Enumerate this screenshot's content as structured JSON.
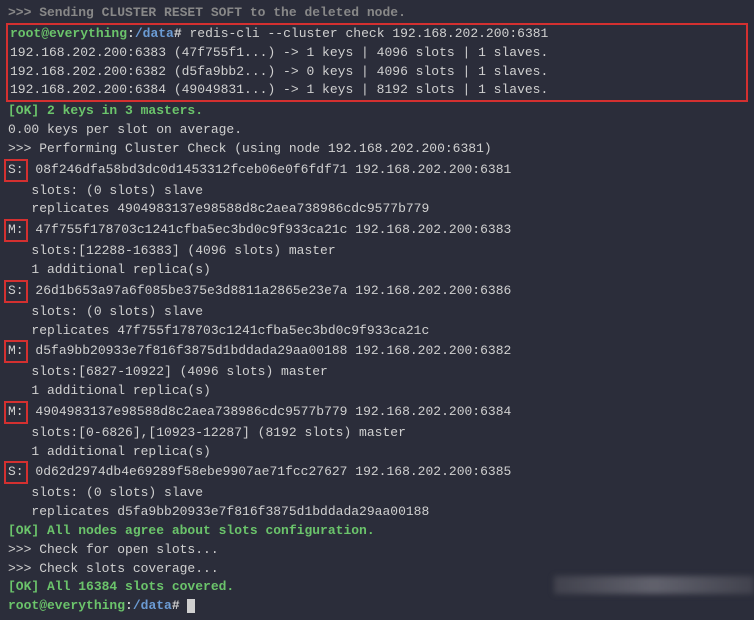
{
  "header_msg": ">>> Sending CLUSTER RESET SOFT to the deleted node.",
  "prompt": {
    "user_host": "root@everything",
    "sep1": ":",
    "path": "/data",
    "sep2": "#"
  },
  "command": "redis-cli --cluster check 192.168.202.200:6381",
  "summary_lines": [
    "192.168.202.200:6383 (47f755f1...) -> 1 keys | 4096 slots | 1 slaves.",
    "192.168.202.200:6382 (d5fa9bb2...) -> 0 keys | 4096 slots | 1 slaves.",
    "192.168.202.200:6384 (49049831...) -> 1 keys | 8192 slots | 1 slaves."
  ],
  "ok_line1": "[OK] 2 keys in 3 masters.",
  "avg_line": "0.00 keys per slot on average.",
  "perf_check": ">>> Performing Cluster Check (using node 192.168.202.200:6381)",
  "nodes": [
    {
      "tag": "S:",
      "id": "08f246dfa58bd3dc0d1453312fceb06e0f6fdf71 192.168.202.200:6381",
      "l2": "   slots: (0 slots) slave",
      "l3": "   replicates 4904983137e98588d8c2aea738986cdc9577b779"
    },
    {
      "tag": "M:",
      "id": "47f755f178703c1241cfba5ec3bd0c9f933ca21c 192.168.202.200:6383",
      "l2": "   slots:[12288-16383] (4096 slots) master",
      "l3": "   1 additional replica(s)"
    },
    {
      "tag": "S:",
      "id": "26d1b653a97a6f085be375e3d8811a2865e23e7a 192.168.202.200:6386",
      "l2": "   slots: (0 slots) slave",
      "l3": "   replicates 47f755f178703c1241cfba5ec3bd0c9f933ca21c"
    },
    {
      "tag": "M:",
      "id": "d5fa9bb20933e7f816f3875d1bddada29aa00188 192.168.202.200:6382",
      "l2": "   slots:[6827-10922] (4096 slots) master",
      "l3": "   1 additional replica(s)"
    },
    {
      "tag": "M:",
      "id": "4904983137e98588d8c2aea738986cdc9577b779 192.168.202.200:6384",
      "l2": "   slots:[0-6826],[10923-12287] (8192 slots) master",
      "l3": "   1 additional replica(s)"
    },
    {
      "tag": "S:",
      "id": "0d62d2974db4e69289f58ebe9907ae71fcc27627 192.168.202.200:6385",
      "l2": "   slots: (0 slots) slave",
      "l3": "   replicates d5fa9bb20933e7f816f3875d1bddada29aa00188"
    }
  ],
  "ok_slots_agree": "[OK] All nodes agree about slots configuration.",
  "check_open": ">>> Check for open slots...",
  "check_cov": ">>> Check slots coverage...",
  "ok_covered": "[OK] All 16384 slots covered."
}
